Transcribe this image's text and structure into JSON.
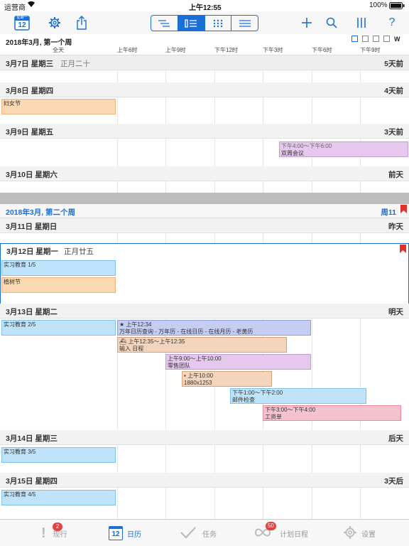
{
  "status": {
    "carrier": "运营商",
    "time": "上午12:55",
    "battery": "100%"
  },
  "toolbar": {
    "calendar_day": "12",
    "calendar_label": "星期一"
  },
  "week1": {
    "title": "2018年3月, 第一个周"
  },
  "week2": {
    "title": "2018年3月, 第二个周",
    "right": "周11"
  },
  "hours": [
    "全天",
    "上午6时",
    "上午9时",
    "下午12时",
    "下午3时",
    "下午6时",
    "下午9时"
  ],
  "view_mode_w": "W",
  "days": [
    {
      "date": "3月7日 星期三",
      "lunar": "正月二十",
      "rel": "5天前"
    },
    {
      "date": "3月8日 星期四",
      "rel": "4天前"
    },
    {
      "date": "3月9日 星期五",
      "rel": "3天前"
    },
    {
      "date": "3月10日 星期六",
      "rel": "前天"
    },
    {
      "date": "3月11日 星期日",
      "rel": "昨天"
    },
    {
      "date": "3月12日 星期一",
      "lunar": "正月廿五",
      "rel": ""
    },
    {
      "date": "3月13日 星期二",
      "rel": "明天"
    },
    {
      "date": "3月14日 星期三",
      "rel": "后天"
    },
    {
      "date": "3月15日 星期四",
      "rel": "3天后"
    }
  ],
  "events": {
    "e1": {
      "title": "妇女节"
    },
    "e2": {
      "time": "下午4:00～下午6:00",
      "title": "双周会议"
    },
    "e3": {
      "title": "实习教育  1/5"
    },
    "e4": {
      "title": "植树节"
    },
    "e5": {
      "title": "实习教育  2/5"
    },
    "e6": {
      "time": "上午12:34",
      "title": "万年日历查询 - 万年历 - 在线日历 - 在线月历 - 老黄历"
    },
    "e7": {
      "time": "上午12:35～上午12:35",
      "title": "输入 日程"
    },
    "e8": {
      "time": "上午9:00～上午10:00",
      "title": "零售团队"
    },
    "e9": {
      "time": "上午10:00",
      "title": "1880x1253"
    },
    "e10": {
      "time": "下午1:00～下午2:00",
      "title": "邮件检查"
    },
    "e11": {
      "time": "下午3:00～下午4:00",
      "title": "工资单"
    },
    "e12": {
      "title": "实习教育  3/5"
    },
    "e13": {
      "title": "实习教育  4/5"
    }
  },
  "tabs": [
    {
      "label": "现行",
      "badge": "2"
    },
    {
      "label": "日历",
      "icon_text": "12"
    },
    {
      "label": "任务"
    },
    {
      "label": "计划日程",
      "badge": "50"
    },
    {
      "label": "设置"
    }
  ],
  "colors": {
    "accent": "#1a6fd6",
    "red_flag": "#e0312c"
  }
}
